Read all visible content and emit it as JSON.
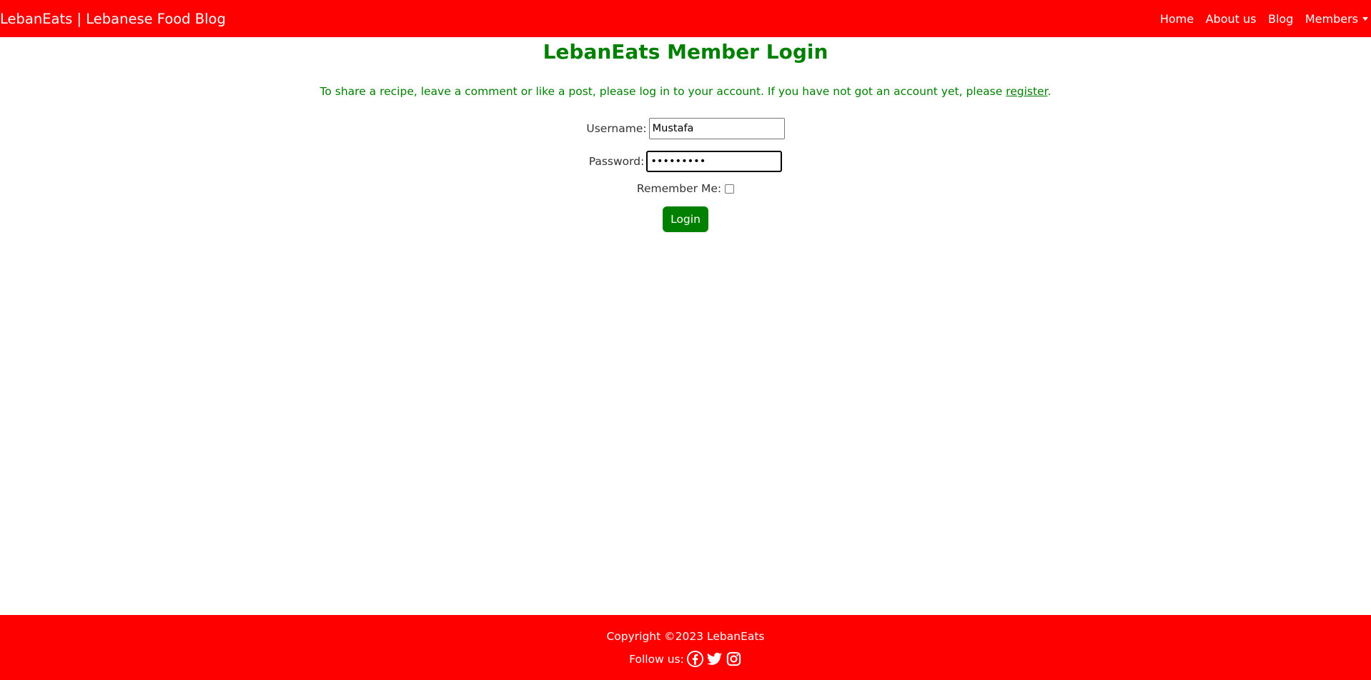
{
  "navbar": {
    "brand": "LebanEats | Lebanese Food Blog",
    "links": [
      {
        "label": "Home"
      },
      {
        "label": "About us"
      },
      {
        "label": "Blog"
      },
      {
        "label": "Members"
      }
    ]
  },
  "main": {
    "title": "LebanEats Member Login",
    "intro_text": "To share a recipe, leave a comment or like a post, please log in to your account. If you have not got an account yet, please ",
    "register_link": "register",
    "intro_end": ".",
    "form": {
      "username_label": "Username:",
      "username_value": "Mustafa",
      "password_label": "Password:",
      "password_value": "•••••••••",
      "remember_label": "Remember Me:",
      "login_button": "Login"
    }
  },
  "footer": {
    "copyright": "Copyright ©2023 LebanEats",
    "follow_label": "Follow us:",
    "social_icons": [
      "facebook-icon",
      "twitter-icon",
      "instagram-icon"
    ]
  },
  "colors": {
    "brand_red": "#ff0000",
    "accent_green": "#008000"
  }
}
